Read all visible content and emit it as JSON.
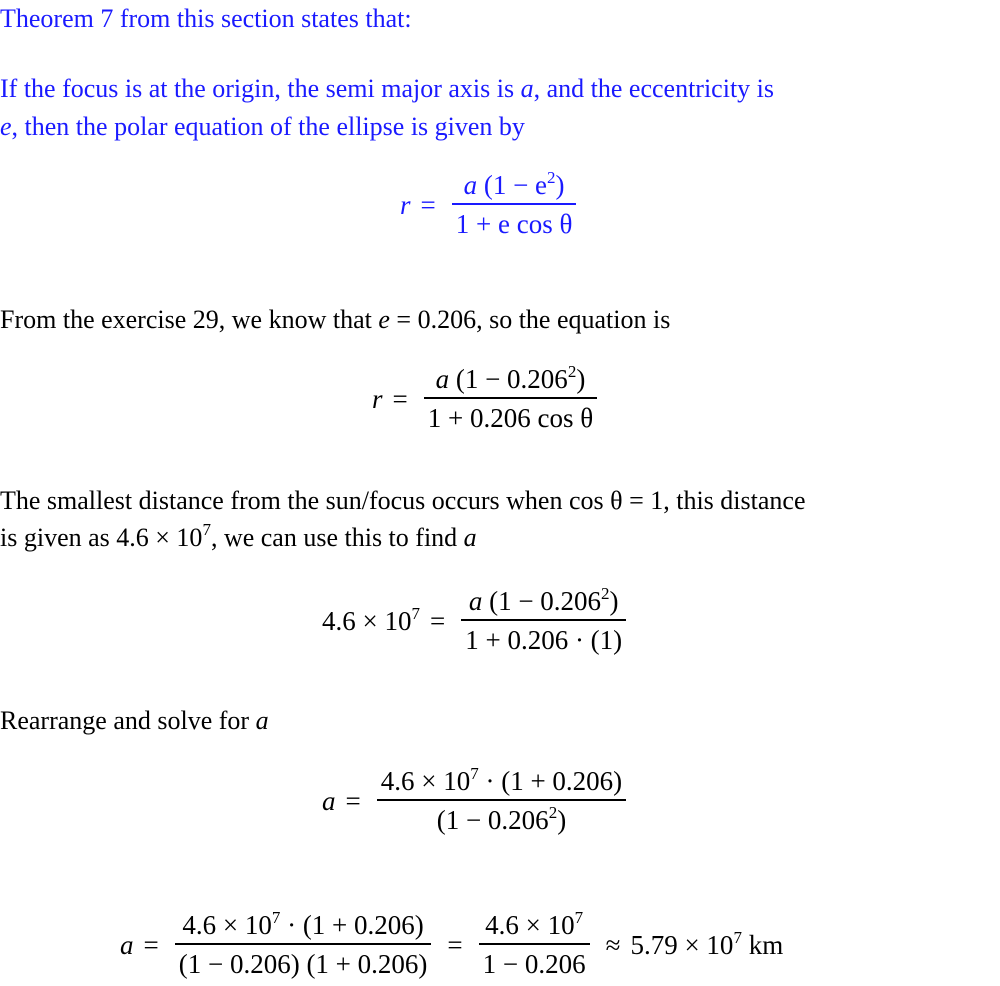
{
  "colors": {
    "theorem_text": "#1a1aff",
    "body_text": "#000000",
    "background": "#ffffff"
  },
  "theorem": {
    "intro": "Theorem 7 from this section states that:",
    "statement_line1_pre": "If the focus is at the origin, the semi major axis is ",
    "statement_var_a": "a",
    "statement_line1_post": ", and the eccentricity is",
    "statement_var_e": "e",
    "statement_line2_post": ", then the polar equation of the ellipse is given by",
    "equation": {
      "lhs": "r",
      "eq": "=",
      "num_a": "a",
      "num_paren": "(1 − e",
      "num_exp": "2",
      "num_close": ")",
      "den": "1 + e cos θ"
    }
  },
  "step1": {
    "text_pre": "From the exercise 29, we know that ",
    "text_var": "e",
    "text_post": " = 0.206, so the equation is",
    "equation": {
      "lhs": "r",
      "eq": "=",
      "num_a": "a",
      "num_paren": "(1 − 0.206",
      "num_exp": "2",
      "num_close": ")",
      "den": "1 + 0.206 cos θ"
    }
  },
  "step2": {
    "line1": "The smallest distance from the sun/focus occurs when cos θ = 1, this distance",
    "line2_pre": "is given as 4.6 × 10",
    "line2_exp": "7",
    "line2_post": ", we can use this to find ",
    "line2_var": "a",
    "equation": {
      "lhs_base": "4.6 × 10",
      "lhs_exp": "7",
      "eq": "=",
      "num_a": "a",
      "num_paren": "(1 − 0.206",
      "num_exp": "2",
      "num_close": ")",
      "den": "1 + 0.206 · (1)"
    }
  },
  "step3": {
    "text_pre": "Rearrange and solve for ",
    "text_var": "a",
    "equation": {
      "lhs": "a",
      "eq": "=",
      "num_base": "4.6 × 10",
      "num_exp": "7",
      "num_post": " · (1 + 0.206)",
      "den_base": "(1 − 0.206",
      "den_exp": "2",
      "den_close": ")"
    }
  },
  "final": {
    "lhs": "a",
    "eq1": "=",
    "frac1_num_base": "4.6 × 10",
    "frac1_num_exp": "7",
    "frac1_num_post": " · (1 + 0.206)",
    "frac1_den": "(1 − 0.206) (1 + 0.206)",
    "eq2": "=",
    "frac2_num_base": "4.6 × 10",
    "frac2_num_exp": "7",
    "frac2_den": "1 − 0.206",
    "approx": "≈",
    "result_base": "5.79 × 10",
    "result_exp": "7",
    "unit": " km"
  }
}
